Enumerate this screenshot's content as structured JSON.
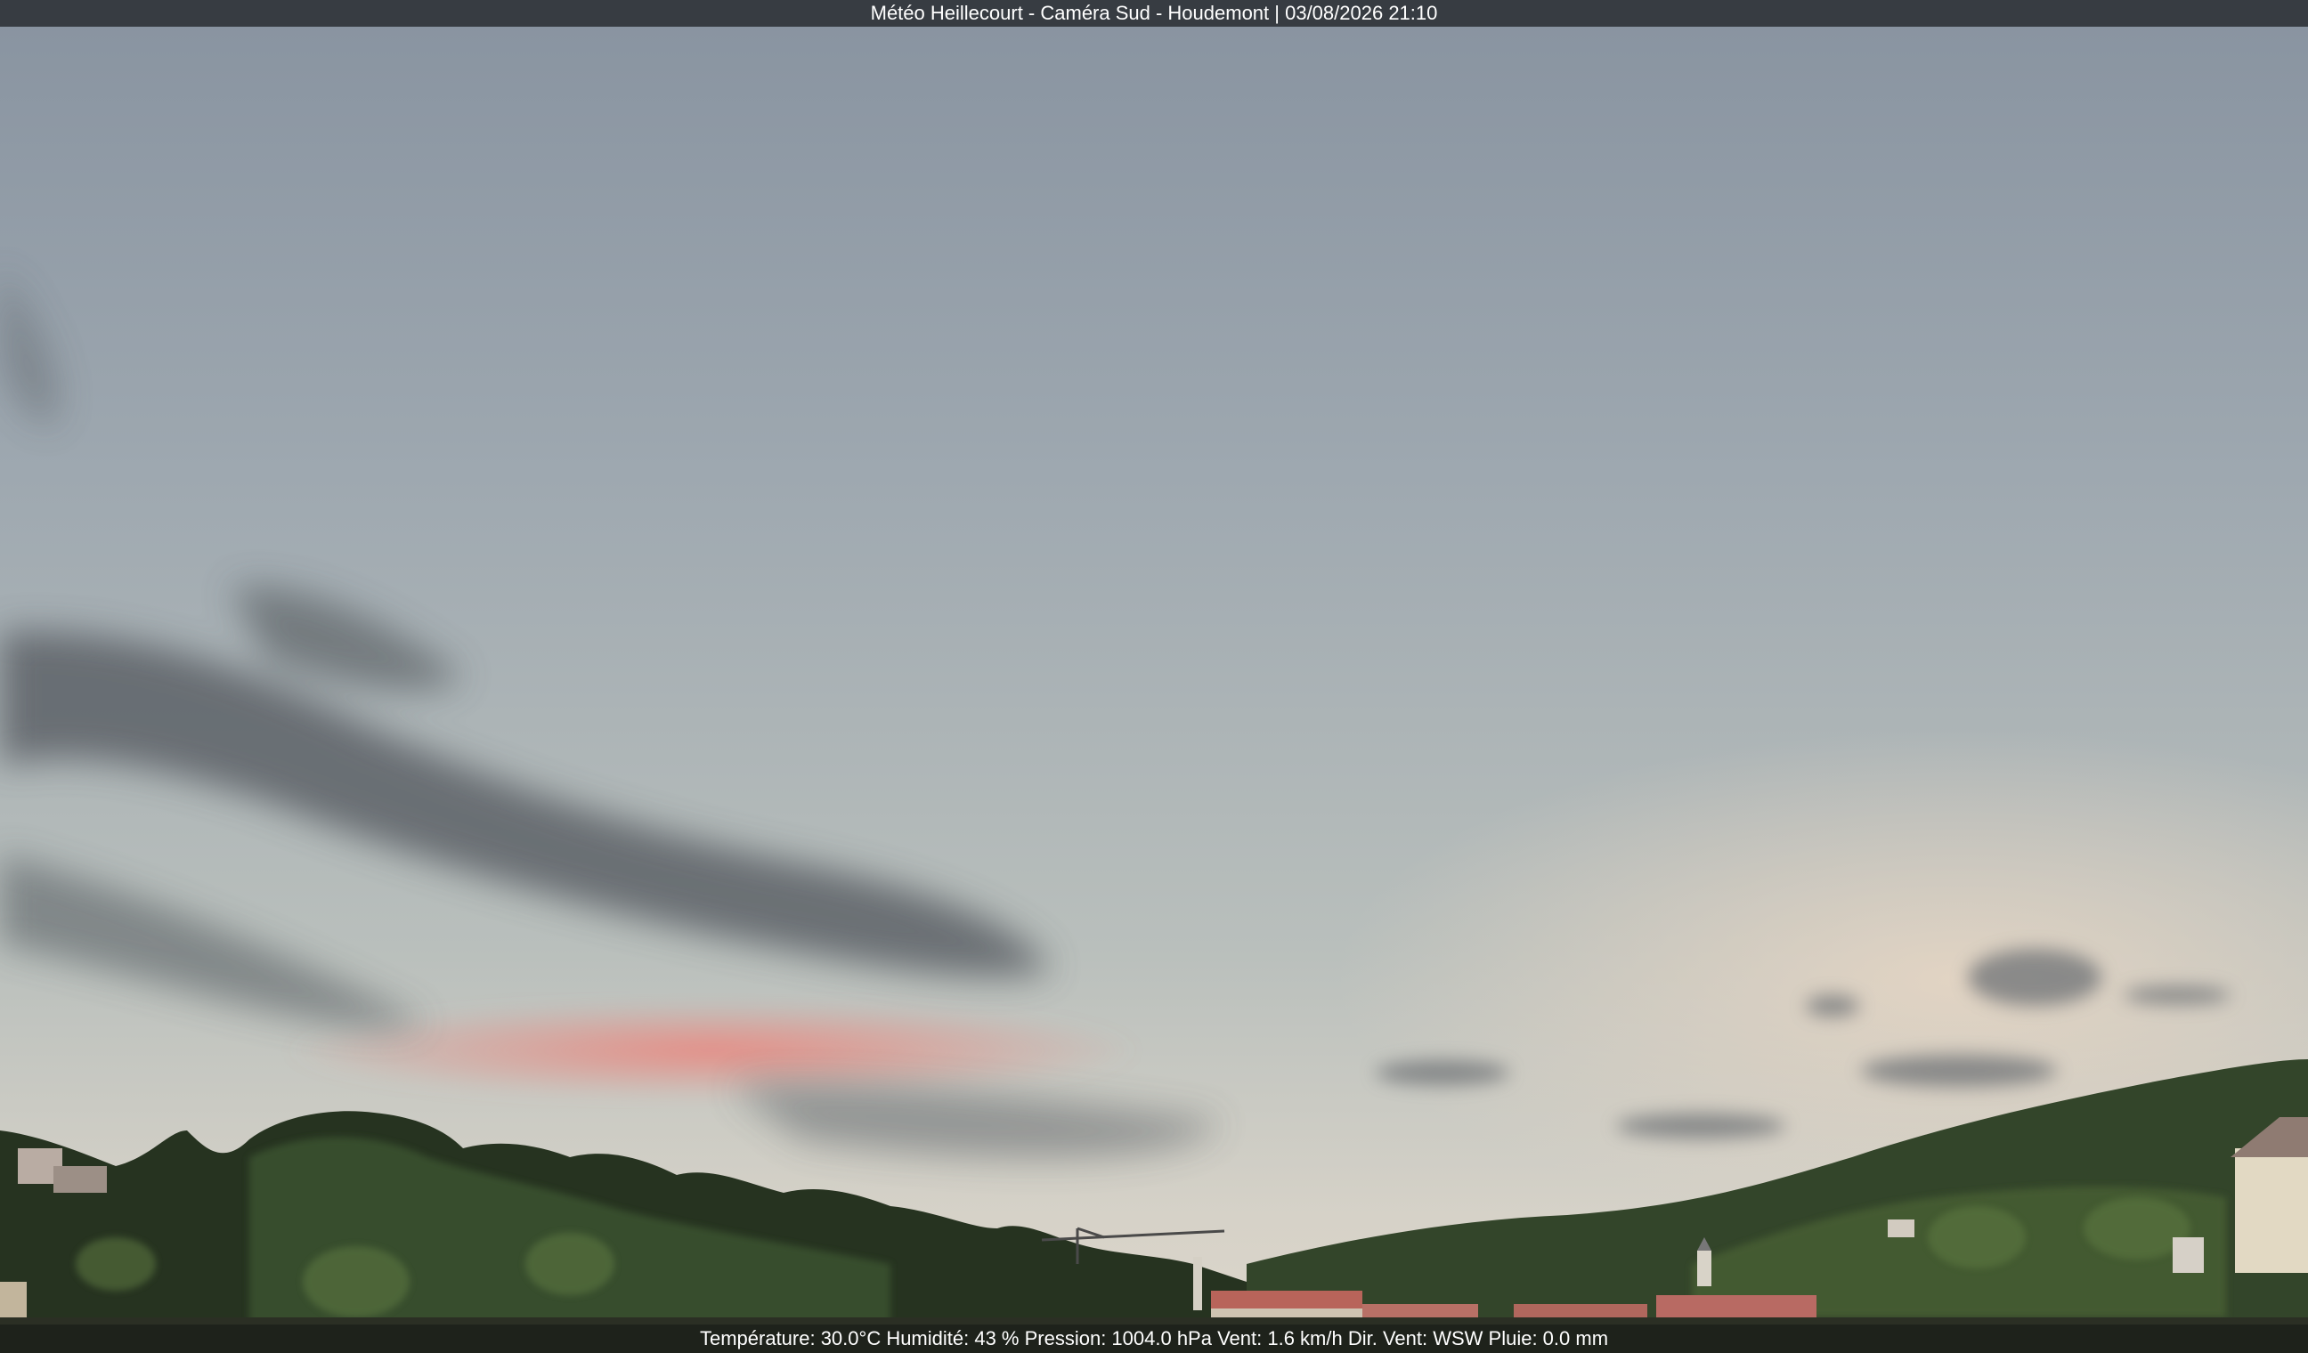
{
  "overlay": {
    "title": "Météo Heillecourt - Caméra Sud - Houdemont | 03/08/2026 21:10",
    "weather_readout": "Température: 30.0°C  Humidité: 43 % Pression: 1004.0 hPa Vent: 1.6 km/h Dir. Vent: WSW Pluie: 0.0 mm"
  },
  "colors": {
    "sky_top": "#8a96a2",
    "sky_mid": "#a7b0b4",
    "sky_horizon": "#d9d2c6",
    "sunset_glow": "#e58a82",
    "cloud_dark": "#5f6469",
    "trees_dark": "#1f2a17",
    "trees_light": "#3f5a2c",
    "hill_right": "#2f3f25"
  }
}
